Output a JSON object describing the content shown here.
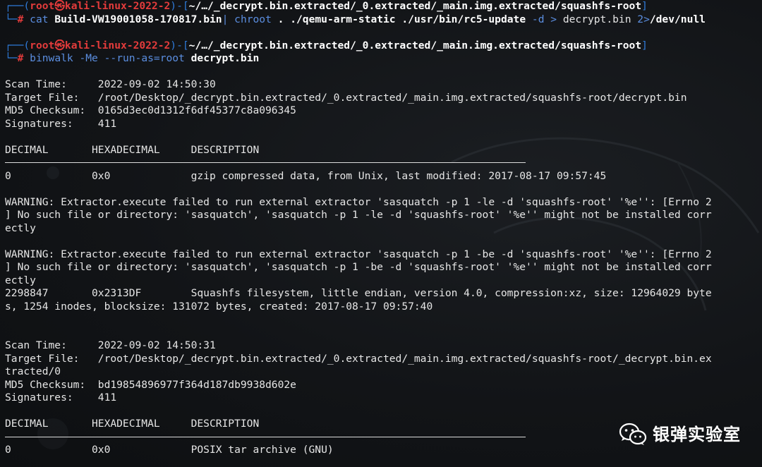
{
  "prompt1": {
    "user": "root",
    "host": "kali-linux-2022-2",
    "path": "~/…/_decrypt.bin.extracted/_0.extracted/_main.img.extracted/squashfs-root",
    "command": "cat",
    "args": "Build-VW19001058-170817.bin",
    "pipe": "|",
    "chroot": "chroot",
    "chroot_args": " . ./qemu-arm-static ./usr/bin/rc5-update ",
    "opt": "-d",
    "redir1": " > ",
    "out_file": "decrypt.bin",
    "redir2": " 2>",
    "null_dev": "/dev/null"
  },
  "prompt2": {
    "user": "root",
    "host": "kali-linux-2022-2",
    "path": "~/…/_decrypt.bin.extracted/_0.extracted/_main.img.extracted/squashfs-root",
    "command": "binwalk",
    "opts": " -Me --run-as=root ",
    "target": "decrypt.bin"
  },
  "scan1": {
    "scan_time": "Scan Time:     2022-09-02 14:50:30",
    "target_file": "Target File:   /root/Desktop/_decrypt.bin.extracted/_0.extracted/_main.img.extracted/squashfs-root/decrypt.bin",
    "md5": "MD5 Checksum:  0165d3ec0d1312f6df45377c8a096345",
    "signatures": "Signatures:    411",
    "header": "DECIMAL       HEXADECIMAL     DESCRIPTION",
    "row1": "0             0x0             gzip compressed data, from Unix, last modified: 2017-08-17 09:57:45",
    "warn1_l1": "WARNING: Extractor.execute failed to run external extractor 'sasquatch -p 1 -le -d 'squashfs-root' '%e'': [Errno 2",
    "warn1_l2": "] No such file or directory: 'sasquatch', 'sasquatch -p 1 -le -d 'squashfs-root' '%e'' might not be installed corr",
    "warn1_l3": "ectly",
    "warn2_l1": "WARNING: Extractor.execute failed to run external extractor 'sasquatch -p 1 -be -d 'squashfs-root' '%e'': [Errno 2",
    "warn2_l2": "] No such file or directory: 'sasquatch', 'sasquatch -p 1 -be -d 'squashfs-root' '%e'' might not be installed corr",
    "warn2_l3": "ectly",
    "row2_l1": "2298847       0x2313DF        Squashfs filesystem, little endian, version 4.0, compression:xz, size: 12964029 byte",
    "row2_l2": "s, 1254 inodes, blocksize: 131072 bytes, created: 2017-08-17 09:57:40"
  },
  "scan2": {
    "scan_time": "Scan Time:     2022-09-02 14:50:31",
    "target_file_l1": "Target File:   /root/Desktop/_decrypt.bin.extracted/_0.extracted/_main.img.extracted/squashfs-root/_decrypt.bin.ex",
    "target_file_l2": "tracted/0",
    "md5": "MD5 Checksum:  bd19854896977f364d187db9938d602e",
    "signatures": "Signatures:    411",
    "header": "DECIMAL       HEXADECIMAL     DESCRIPTION",
    "row1": "0             0x0             POSIX tar archive (GNU)"
  },
  "watermark": {
    "text": "银弹实验室",
    "icon": "wechat-icon"
  }
}
